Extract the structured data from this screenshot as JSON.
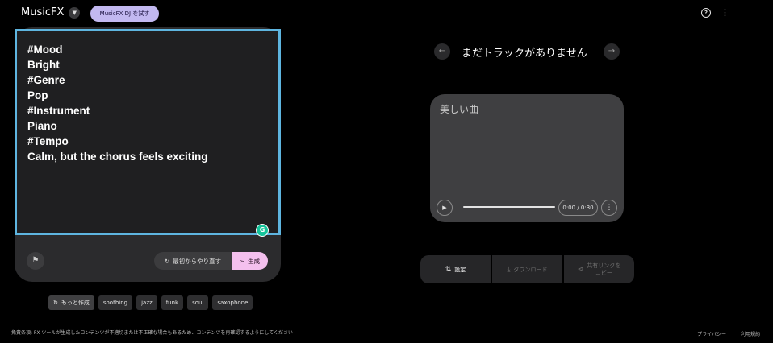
{
  "header": {
    "app_name": "MusicFX",
    "try_dj_label": "MusicFX DJ を試す"
  },
  "prompt": {
    "text": "#Mood\nBright\n#Genre\nPop\n#Instrument\nPiano\n#Tempo\nCalm, but the chorus feels exciting"
  },
  "composer": {
    "restart_label": "最初からやり直す",
    "generate_label": "生成"
  },
  "chips": {
    "more_label": "もっと作成",
    "suggestions": [
      "soothing",
      "jazz",
      "funk",
      "soul",
      "saxophone"
    ]
  },
  "disclaimer": "免責条項: FX ツールが生成したコンテンツが不適切または不正確な場合もあるため、コンテンツを再確認するようにしてください",
  "footer": {
    "privacy": "プライバシー",
    "terms": "利用規約"
  },
  "track": {
    "nav_title": "まだトラックがありません",
    "name": "美しい曲",
    "time": "0:00 / 0:30",
    "progress_fraction": 0
  },
  "actions": {
    "settings": "設定",
    "download": "ダウンロード",
    "share_line1": "共有リンクを",
    "share_line2": "コピー"
  },
  "colors": {
    "accent_purple": "#c2b8f0",
    "generate_pink": "#f4c0ee",
    "selection_blue": "#5eb5e0"
  }
}
